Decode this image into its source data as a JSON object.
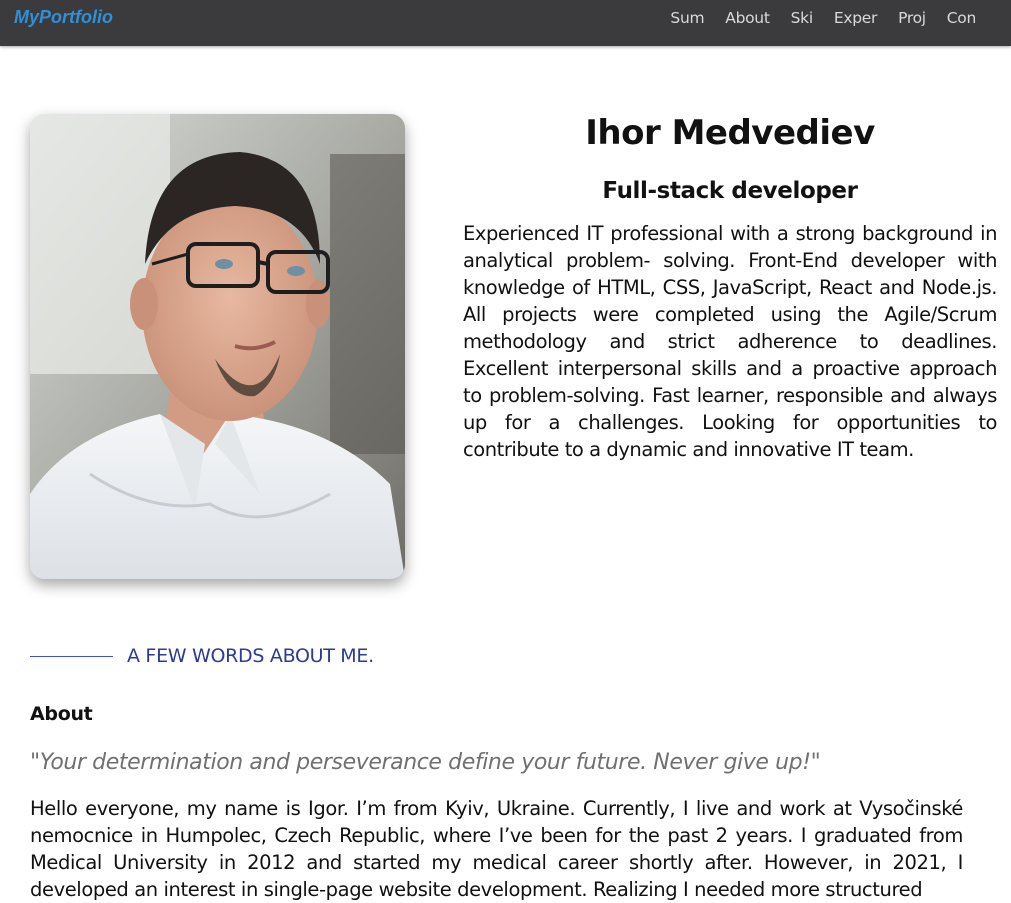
{
  "navbar": {
    "brand": "MyPortfolio",
    "links": [
      "Sum",
      "About",
      "Ski",
      "Exper",
      "Proj",
      "Con"
    ],
    "background": "#3b3b3d",
    "brand_color": "#2f8fd8"
  },
  "profile": {
    "name": "Ihor Medvediev",
    "role": "Full-stack developer",
    "summary": "Experienced IT professional with a strong background in analytical problem- solving. Front-End developer with knowledge of HTML, CSS, JavaScript, React and Node.js. All projects were completed using the Agile/Scrum methodology and strict adherence to deadlines. Excellent interpersonal skills and a proactive approach to problem-solving. Fast learner, responsible and always up for a challenges. Looking for opportunities to contribute to a dynamic and innovative IT team."
  },
  "about": {
    "section_heading": "A FEW WORDS ABOUT ME.",
    "title": "About",
    "quote": "\"Your determination and perseverance define your future. Never give up!\"",
    "text": "Hello everyone, my name is Igor. I’m from Kyiv, Ukraine. Currently, I live and work at Vysočinské nemocnice in Humpolec, Czech Republic, where I’ve been for the past 2 years. I graduated from Medical University in 2012 and started my medical career shortly after. However, in 2021, I developed an interest in single-page website development. Realizing I needed more structured"
  },
  "colors": {
    "accent": "#2b3a9b",
    "quote": "#707070"
  }
}
